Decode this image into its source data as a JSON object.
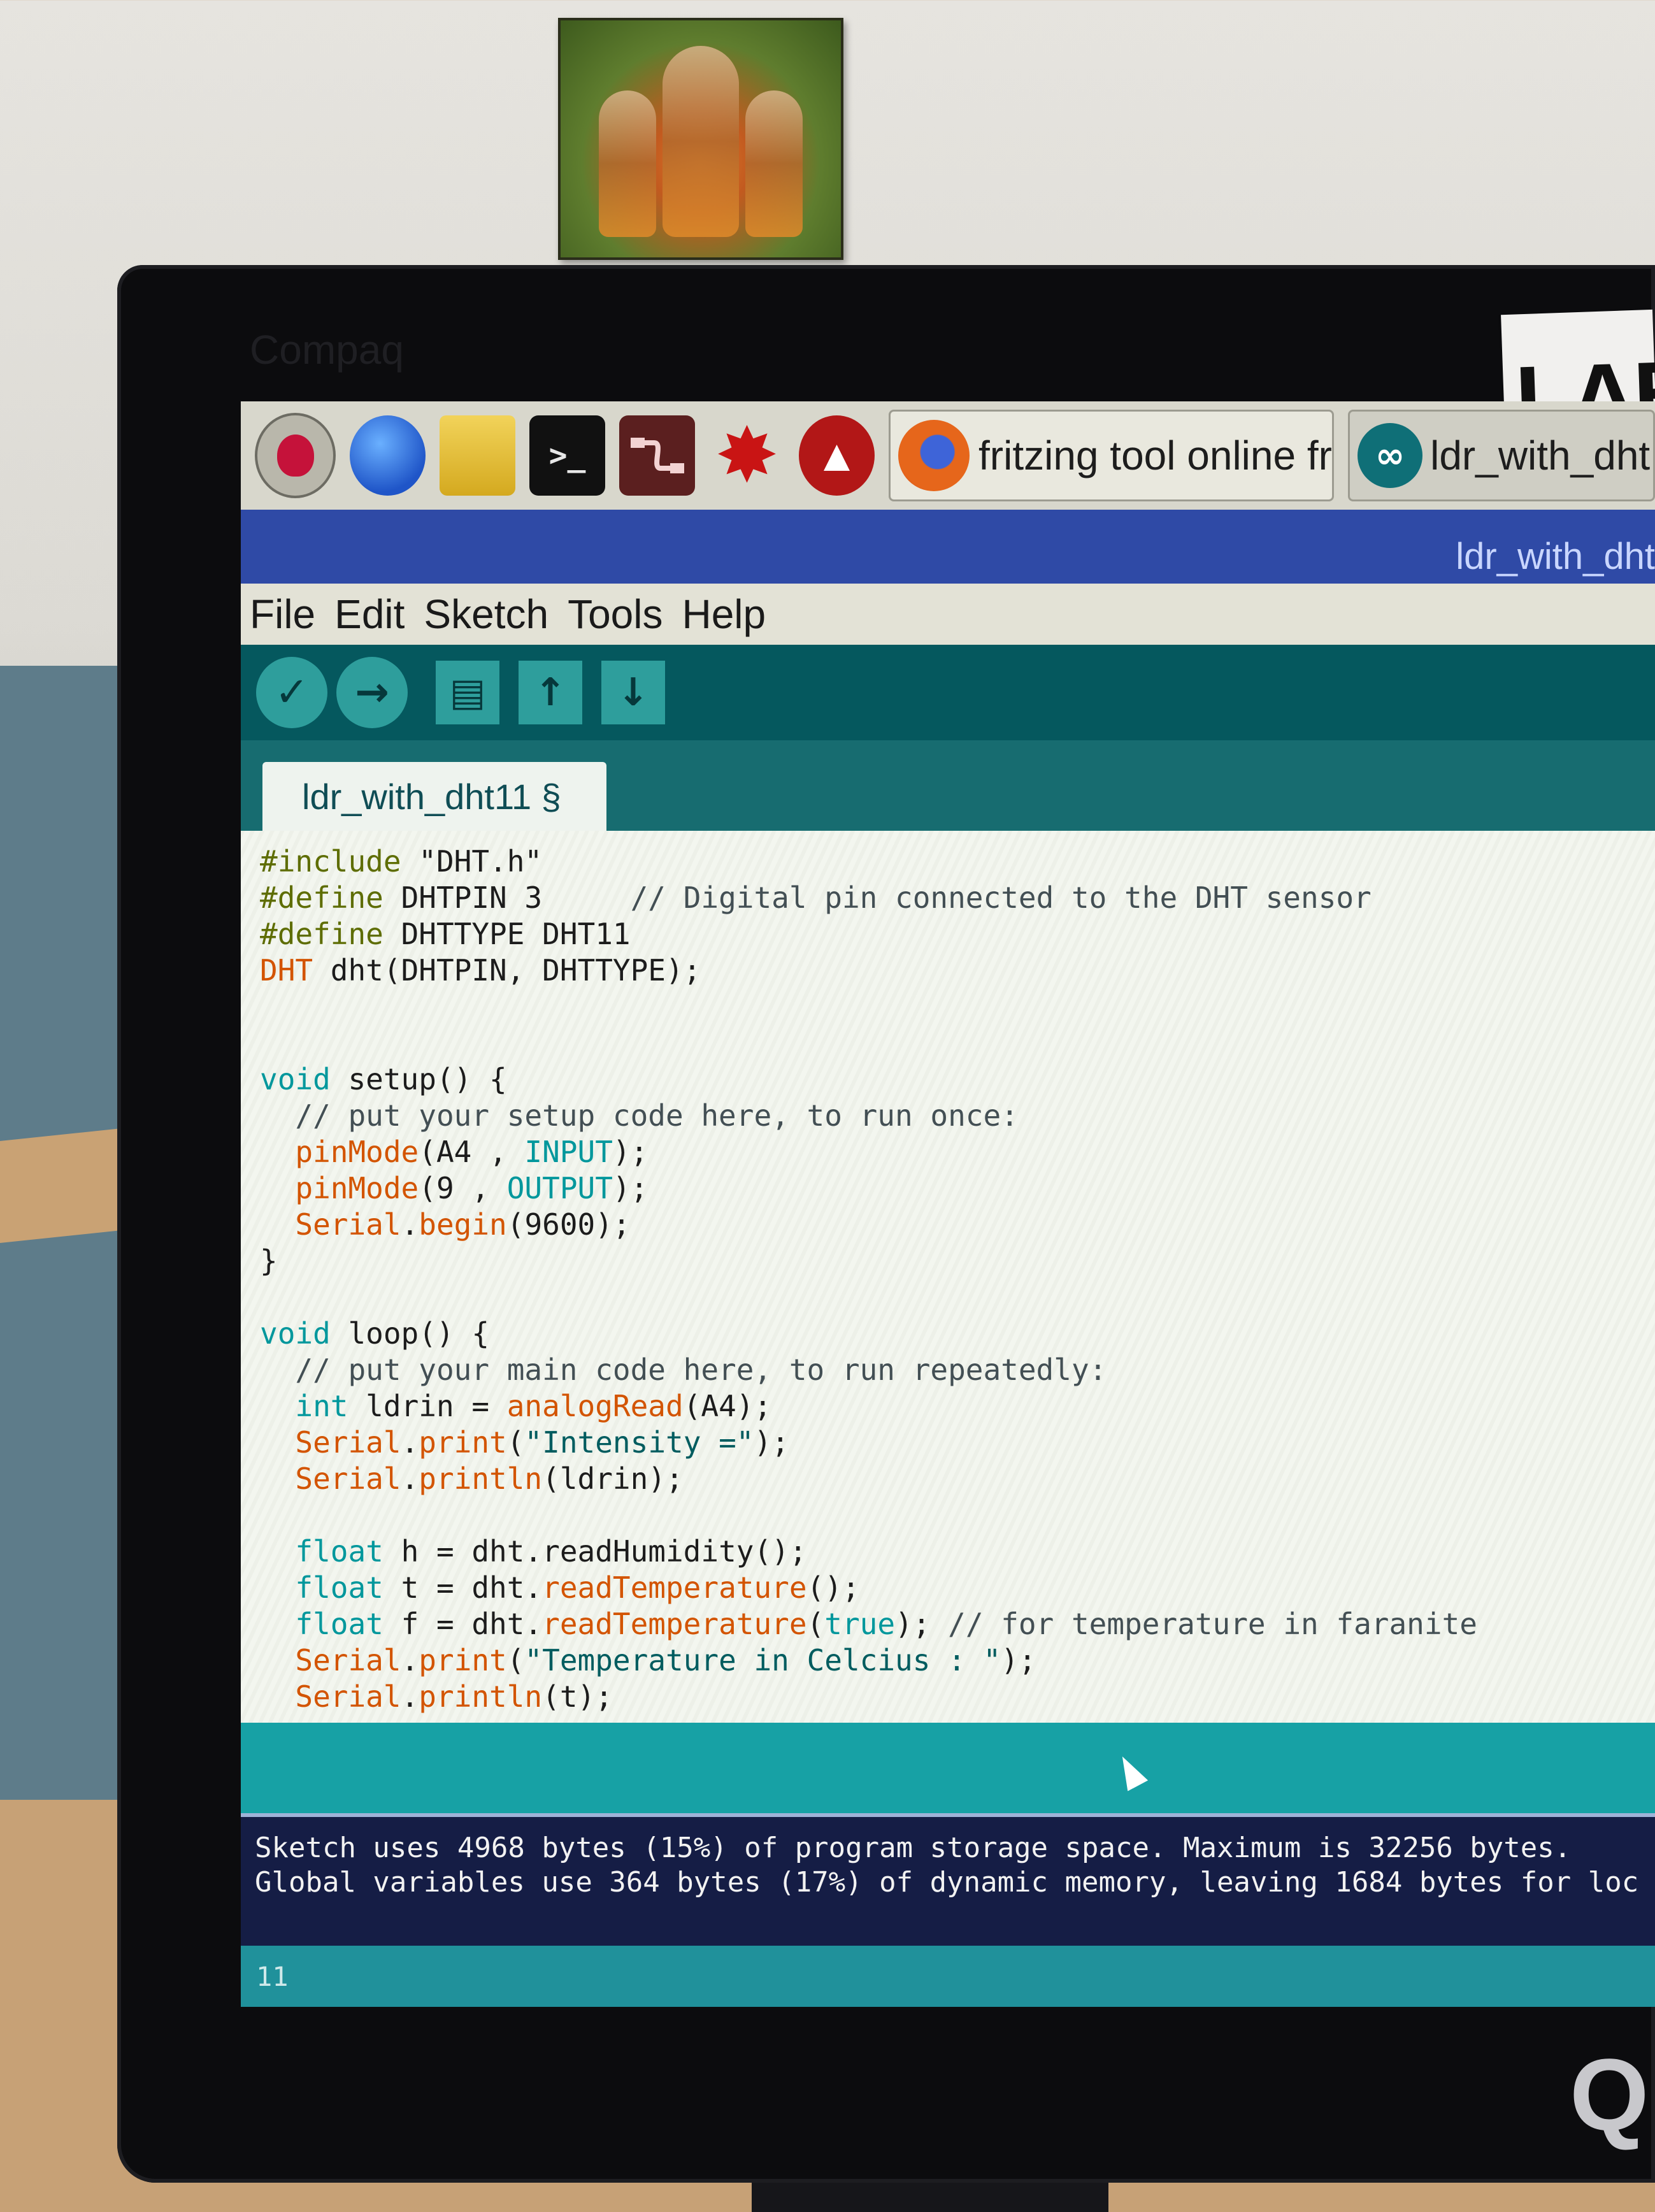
{
  "monitor": {
    "brand": "Compaq",
    "sticker": "LAB"
  },
  "taskbar": {
    "icons": [
      "raspberry-pi-menu-icon",
      "web-browser-icon",
      "file-manager-icon",
      "terminal-icon",
      "node-red-icon",
      "mathematica-icon",
      "wolfram-icon"
    ],
    "tasks": [
      {
        "label": "fritzing tool online fre...",
        "icon": "firefox-icon"
      },
      {
        "label": "ldr_with_dht",
        "icon": "arduino-icon"
      }
    ]
  },
  "window": {
    "title": "ldr_with_dht"
  },
  "menu": [
    "File",
    "Edit",
    "Sketch",
    "Tools",
    "Help"
  ],
  "toolbar": {
    "verify": "✓",
    "upload": "→",
    "new": "▤",
    "open": "↑",
    "save": "↓"
  },
  "tab": {
    "label": "ldr_with_dht11 §"
  },
  "code": {
    "l1a": "#include",
    "l1b": " \"DHT.h\"",
    "l2a": "#define",
    "l2b": " DHTPIN 3     ",
    "l2c": "// Digital pin connected to the DHT sensor",
    "l3a": "#define",
    "l3b": " DHTTYPE DHT11",
    "l4a": "DHT",
    "l4b": " dht(DHTPIN, DHTTYPE);",
    "l7a": "void",
    "l7b": " setup() {",
    "l8": "  // put your setup code here, to run once:",
    "l9a": "  pinMode",
    "l9b": "(A4 , ",
    "l9c": "INPUT",
    "l9d": ");",
    "l10a": "  pinMode",
    "l10b": "(9 , ",
    "l10c": "OUTPUT",
    "l10d": ");",
    "l11a": "  Serial",
    "l11b": ".",
    "l11c": "begin",
    "l11d": "(9600);",
    "l12": "}",
    "l14a": "void",
    "l14b": " loop() {",
    "l15": "  // put your main code here, to run repeatedly:",
    "l16a": "  int",
    "l16b": " ldrin = ",
    "l16c": "analogRead",
    "l16d": "(A4);",
    "l17a": "  Serial",
    "l17b": ".",
    "l17c": "print",
    "l17d": "(",
    "l17e": "\"Intensity =\"",
    "l17f": ");",
    "l18a": "  Serial",
    "l18b": ".",
    "l18c": "println",
    "l18d": "(ldrin);",
    "l20a": "  float",
    "l20b": " h = dht.",
    "l20c": "readHumidity",
    "l20d": "();",
    "l21a": "  float",
    "l21b": " t = dht.",
    "l21c": "readTemperature",
    "l21d": "();",
    "l22a": "  float",
    "l22b": " f = dht.",
    "l22c": "readTemperature",
    "l22d": "(",
    "l22e": "true",
    "l22f": "); ",
    "l22g": "// for temperature in faranite",
    "l23a": "  Serial",
    "l23b": ".",
    "l23c": "print",
    "l23d": "(",
    "l23e": "\"Temperature in Celcius : \"",
    "l23f": ");",
    "l24a": "  Serial",
    "l24b": ".",
    "l24c": "println",
    "l24d": "(t);"
  },
  "console": {
    "line1": "Sketch uses 4968 bytes (15%) of program storage space. Maximum is 32256 bytes.",
    "line2": "Global variables use 364 bytes (17%) of dynamic memory, leaving 1684 bytes for loc"
  },
  "footer": {
    "line_number": "11"
  }
}
